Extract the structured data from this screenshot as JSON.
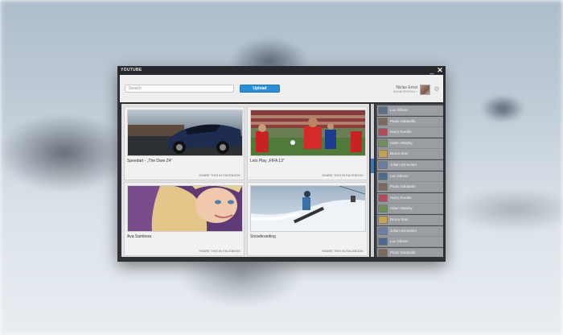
{
  "app": {
    "title": "YOUTUBE",
    "minimize": "_",
    "close": "✕"
  },
  "header": {
    "search_placeholder": "Search",
    "upload_label": "Upload",
    "user_name": "Niclas Ernst",
    "user_subtitle": "SHOW PROFILE >",
    "settings_icon": "⚙"
  },
  "videos": [
    {
      "title": "Speedart - „The Dare Z4“",
      "share": "SHARE THIS IN FACEBOOK",
      "thumb": "car"
    },
    {
      "title": "Lets Play „FIFA 13“",
      "share": "SHARE THIS IN FACEBOOK",
      "thumb": "football"
    },
    {
      "title": "Ava Sambora",
      "share": "SHARE THIS IN FACEBOOK",
      "thumb": "portrait"
    },
    {
      "title": "Snowboarding",
      "share": "SHARE THIS IN FACEBOOK",
      "thumb": "snow"
    }
  ],
  "friends": [
    {
      "name": "Luc Gibson",
      "color": "#5a6f8a"
    },
    {
      "name": "Paolo Sabatella",
      "color": "#7d6a5c"
    },
    {
      "name": "Harry Rundle",
      "color": "#b04b5a"
    },
    {
      "name": "Adam Walshy",
      "color": "#6e8f5a"
    },
    {
      "name": "Bruno Stan",
      "color": "#c2a24c"
    },
    {
      "name": "Julian Schneider",
      "color": "#6a7ea0"
    },
    {
      "name": "Luc Gibson",
      "color": "#4e6b8e"
    },
    {
      "name": "Paolo Sabatella",
      "color": "#7b6b5b"
    },
    {
      "name": "Harry Rundle",
      "color": "#b24b5d"
    },
    {
      "name": "Adam Walshy",
      "color": "#6c8e57"
    },
    {
      "name": "Bruno Stan",
      "color": "#c4a54f"
    },
    {
      "name": "Julian Schneider",
      "color": "#6b7fa2"
    },
    {
      "name": "Luc Gibson",
      "color": "#4c6a8d"
    },
    {
      "name": "Paolo Sabatella",
      "color": "#7a6a5a"
    }
  ]
}
